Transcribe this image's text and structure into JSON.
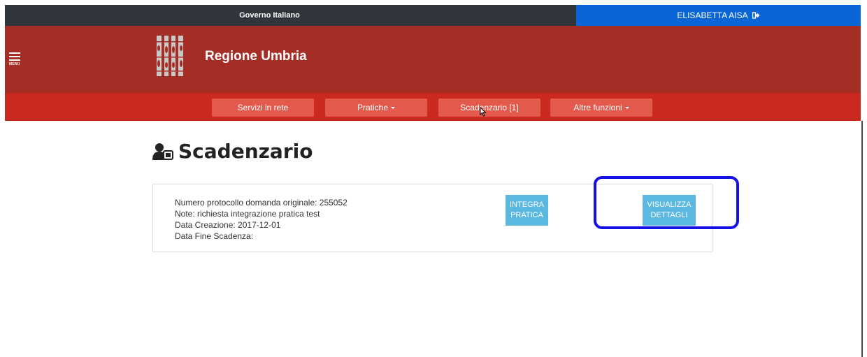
{
  "gov_bar": {
    "title": "Governo Italiano",
    "user_name": "ELISABETTA AISA"
  },
  "header": {
    "menu_label": "MENU",
    "site_title": "Regione Umbria"
  },
  "nav": {
    "items": [
      {
        "label": "Servizi in rete",
        "dropdown": false
      },
      {
        "label": "Pratiche",
        "dropdown": true
      },
      {
        "label": "Scadenzario [1]",
        "dropdown": false
      },
      {
        "label": "Altre funzioni",
        "dropdown": true
      }
    ]
  },
  "page": {
    "title": "Scadenzario"
  },
  "record": {
    "protocol": "Numero protocollo domanda originale: 255052",
    "note": "Note: richiesta integrazione pratica test",
    "created": "Data Creazione: 2017-12-01",
    "expiry": "Data Fine Scadenza:",
    "integra_line1": "INTEGRA",
    "integra_line2": "PRATICA",
    "visualizza_line1": "VISUALIZZA",
    "visualizza_line2": "DETTAGLI"
  },
  "colors": {
    "gov_bar": "#2f353b",
    "user_bar": "#0a66d6",
    "header": "#a42e26",
    "nav_bar": "#c9291f",
    "nav_item": "#e35a4c",
    "button": "#5bb8e1",
    "highlight": "#1411e6"
  }
}
